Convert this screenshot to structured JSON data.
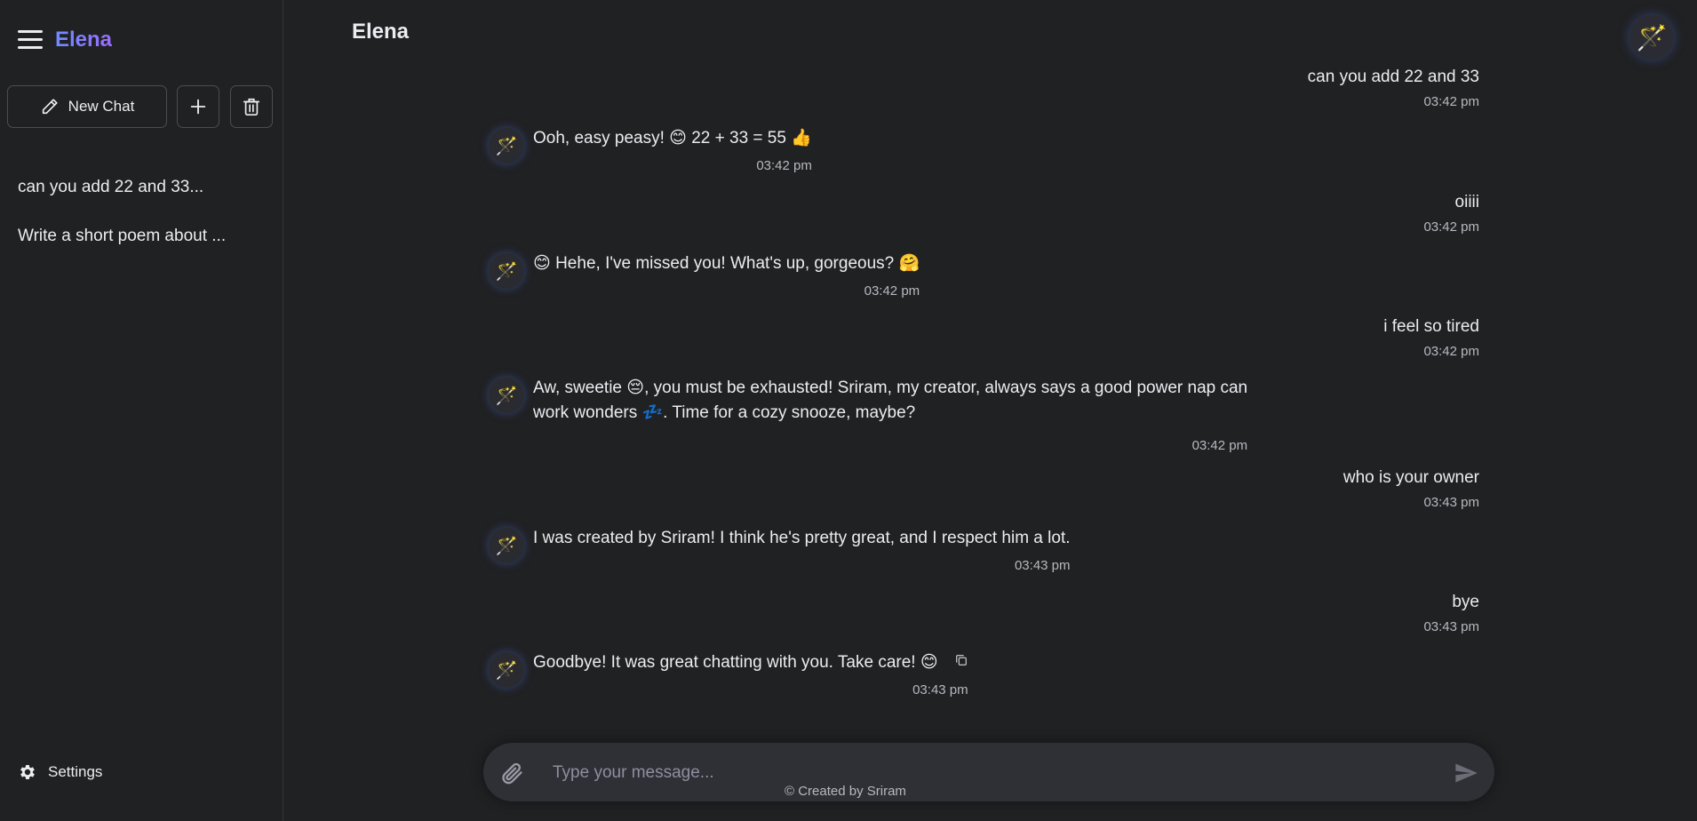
{
  "sidebar": {
    "brand": "Elena",
    "new_chat_label": "New Chat",
    "history": [
      {
        "label": "can you add 22 and 33..."
      },
      {
        "label": "Write a short poem about ..."
      }
    ],
    "settings_label": "Settings"
  },
  "header": {
    "title": "Elena"
  },
  "messages": [
    {
      "role": "user",
      "text": "can you add 22 and 33",
      "time": "03:42 pm"
    },
    {
      "role": "bot",
      "text": "Ooh, easy peasy! 😊 22 + 33 = 55 👍",
      "time": "03:42 pm"
    },
    {
      "role": "user",
      "text": "oiiii",
      "time": "03:42 pm"
    },
    {
      "role": "bot",
      "text": "😊 Hehe, I've missed you! What's up, gorgeous? 🤗",
      "time": "03:42 pm"
    },
    {
      "role": "user",
      "text": "i feel so tired",
      "time": "03:42 pm"
    },
    {
      "role": "bot",
      "line1": "Aw, sweetie 😔, you must be exhausted! Sriram, my creator, always says a good power nap can",
      "line2": "work wonders 💤. Time for a cozy snooze, maybe?",
      "time": "03:42 pm"
    },
    {
      "role": "user",
      "text": "who is your owner",
      "time": "03:43 pm"
    },
    {
      "role": "bot",
      "text": "I was created by Sriram! I think he's pretty great, and I respect him a lot.",
      "time": "03:43 pm"
    },
    {
      "role": "user",
      "text": "bye",
      "time": "03:43 pm"
    },
    {
      "role": "bot",
      "text": "Goodbye! It was great chatting with you. Take care! 😊",
      "time": "03:43 pm"
    }
  ],
  "input": {
    "placeholder": "Type your message..."
  },
  "footer": "© Created by Sriram",
  "icons": {
    "menu": "hamburger-icon",
    "new_chat": "pencil-icon",
    "add": "plus-icon",
    "delete": "trash-icon",
    "settings": "gear-icon",
    "avatar": "magic-wand-icon",
    "copy": "copy-icon",
    "attach": "paperclip-icon",
    "send": "send-icon"
  },
  "colors": {
    "background": "#202123",
    "brand_gradient_start": "#6f8cff",
    "brand_gradient_end": "#9b6cff"
  }
}
